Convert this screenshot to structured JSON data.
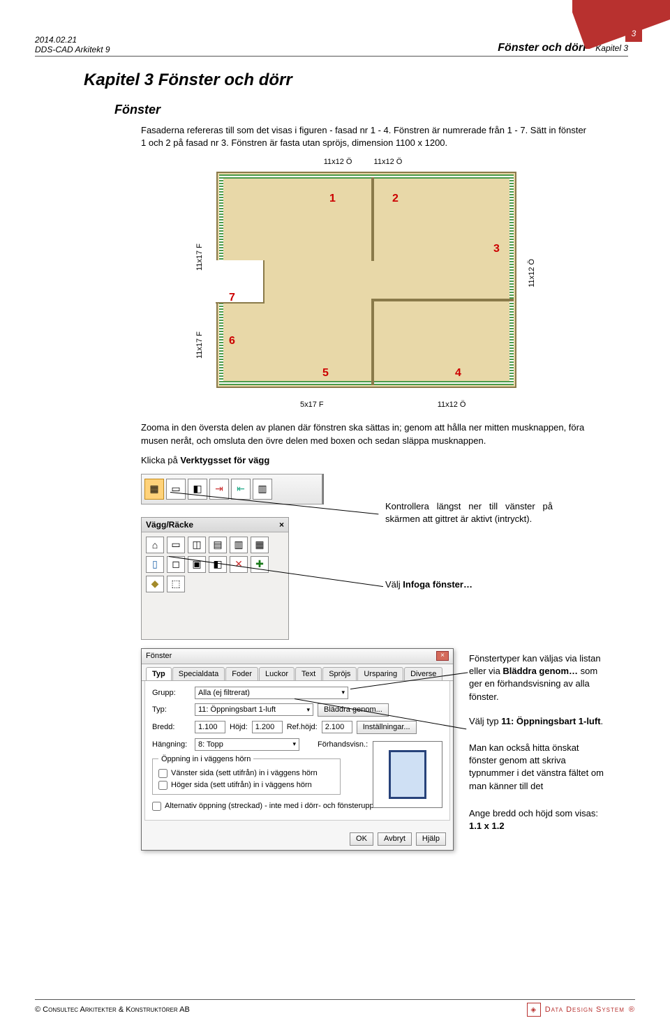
{
  "header": {
    "date": "2014.02.21",
    "product": "DDS-CAD Arkitekt 9",
    "section_title": "Fönster och dörr",
    "chapter_label": "Kapitel 3",
    "page_number": "3"
  },
  "chapter": {
    "title": "Kapitel 3  Fönster och dörr",
    "subhead": "Fönster"
  },
  "paragraphs": {
    "p1": "Fasaderna refereras till som det visas i figuren - fasad nr 1 -  4. Fönstren är numrerade från 1 - 7. Sätt in fönster 1 och 2 på fasad nr 3. Fönstren är fasta utan spröjs, dimension 1100 x 1200.",
    "p2": "Zooma in den översta delen av planen där fönstren ska sättas in; genom att hålla ner mitten musknappen, föra musen neråt, och omsluta den övre delen med boxen och sedan släppa musknappen.",
    "p3_pre": "Klicka på ",
    "p3_bold": "Verktygsset för vägg"
  },
  "floorplan": {
    "top_labels": [
      "11x12 Ö",
      "11x12 Ö"
    ],
    "right_label": "11x12 Ö",
    "left_labels": [
      "11x17 F",
      "11x17 F"
    ],
    "bottom_labels": [
      "5x17 F",
      "11x12 Ö"
    ],
    "numbers": [
      "1",
      "2",
      "3",
      "4",
      "5",
      "6",
      "7"
    ]
  },
  "toolbar": {
    "panel_title": "Vägg/Räcke",
    "panel_close": "×",
    "annotation1": "Kontrollera längst ner till vänster på skärmen att gittret är aktivt (intryckt).",
    "annotation2_pre": "Välj ",
    "annotation2_bold": "Infoga fönster…"
  },
  "dialog": {
    "title": "Fönster",
    "close": "×",
    "tabs": [
      "Typ",
      "Specialdata",
      "Foder",
      "Luckor",
      "Text",
      "Spröjs",
      "Ursparing",
      "Diverse"
    ],
    "group_label": "Grupp:",
    "group_value": "Alla (ej filtrerat)",
    "type_label": "Typ:",
    "type_value": "11: Öppningsbart 1-luft",
    "browse_label": "Bläddra genom...",
    "width_label": "Bredd:",
    "width_value": "1.100",
    "height_label": "Höjd:",
    "height_value": "1.200",
    "refheight_label": "Ref.höjd:",
    "refheight_value": "2.100",
    "settings_label": "Inställningar...",
    "hang_label": "Hängning:",
    "hang_value": "8: Topp",
    "preview_label": "Förhandsvisn.:",
    "opening_group": "Öppning in i väggens hörn",
    "chk_left": "Vänster sida (sett utifrån) in i väggens hörn",
    "chk_right": "Höger sida (sett utifrån) in i väggens hörn",
    "chk_alt": "Alternativ öppning (streckad) - inte med i dörr- och fönsteruppst.",
    "btn_ok": "OK",
    "btn_cancel": "Avbryt",
    "btn_help": "Hjälp"
  },
  "side_notes": {
    "n1a": "Fönstertyper kan väljas via listan eller via ",
    "n1b": "Bläddra genom…",
    "n1c": " som ger en förhandsvisning av alla fönster.",
    "n2a": "Välj typ ",
    "n2b": "11: Öppningsbart 1-luft",
    "n2c": ".",
    "n3": "Man kan också hitta önskat fönster genom att skriva typnummer i det vänstra fältet om man känner till det",
    "n4a": "Ange bredd och höjd som visas:",
    "n4b": "1.1 x 1.2"
  },
  "footer": {
    "left_prefix": "© ",
    "left_text": "Consultec Arkitekter & Konstruktörer AB",
    "right_text": "Data Design System",
    "right_mark": "®"
  }
}
